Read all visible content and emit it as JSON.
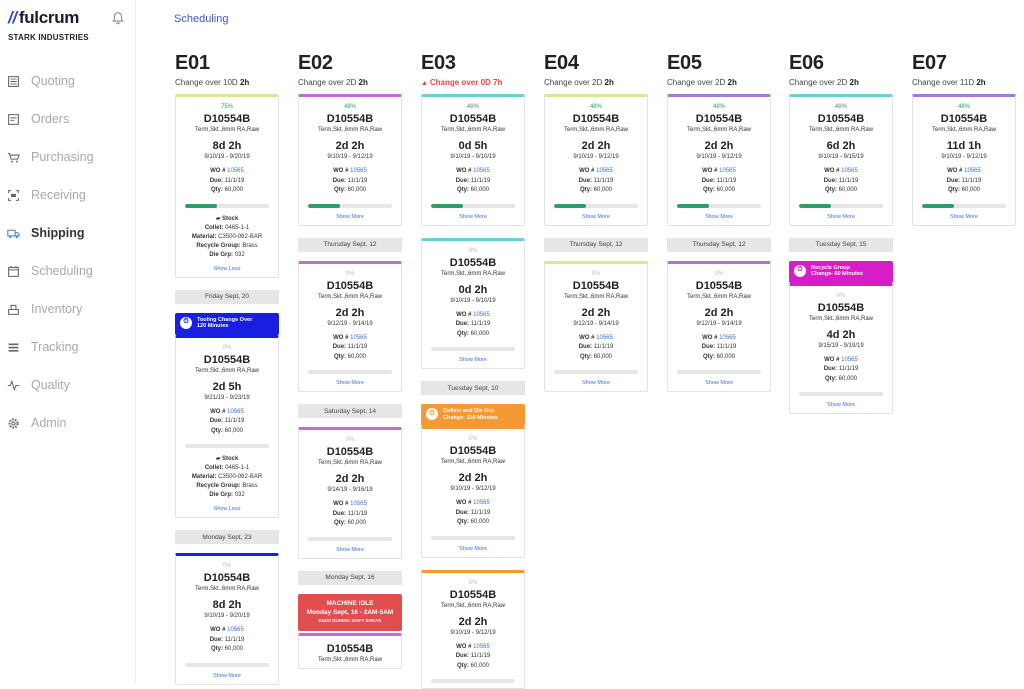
{
  "app": {
    "brand": "fulcrum",
    "company": "STARK INDUSTRIES"
  },
  "sidebar": {
    "items": [
      {
        "label": "Quoting",
        "icon": "quoting-icon"
      },
      {
        "label": "Orders",
        "icon": "orders-icon"
      },
      {
        "label": "Purchasing",
        "icon": "cart-icon"
      },
      {
        "label": "Receiving",
        "icon": "scan-icon"
      },
      {
        "label": "Shipping",
        "icon": "truck-icon",
        "active": true
      },
      {
        "label": "Scheduling",
        "icon": "calendar-icon"
      },
      {
        "label": "Inventory",
        "icon": "inventory-icon"
      },
      {
        "label": "Tracking",
        "icon": "tracking-icon"
      },
      {
        "label": "Quality",
        "icon": "pulse-icon"
      },
      {
        "label": "Admin",
        "icon": "gear-icon"
      }
    ]
  },
  "breadcrumb": "Scheduling",
  "colors": {
    "accent": "#3848c8",
    "green": "#2e9d68",
    "alert": "#e04848",
    "tooling": "#1a1ee0",
    "collets": "#f49a34",
    "recycle": "#d91cc9",
    "idle": "#e14e4e"
  },
  "machines": [
    {
      "id": "E01",
      "changeover_label": "Change over ",
      "changeover_days": "10D",
      "changeover_hours": "2h",
      "alert": false,
      "items": [
        {
          "type": "card",
          "color": "#dbe59a",
          "pct": "75%",
          "pct_color": "g",
          "part": "D10554B",
          "desc": "Term,Skt.,6mm RA,Raw",
          "dur": "8d 2h",
          "dates": "9/10/19 - 9/20/19",
          "wo": "10565",
          "due": "11/1/19",
          "qty": "60,000",
          "progress": 0.38,
          "tooling": {
            "stock": "Stock",
            "collet": "0465-1-1",
            "material": "C3500-062-BAR",
            "recycle": "Brass",
            "die": "032"
          },
          "more": "Show Less"
        },
        {
          "type": "date",
          "label": "Friday Sept, 20"
        },
        {
          "type": "change",
          "color": "#1a1ee0",
          "title": "Tooling Change Over",
          "sub": "120 Minutes"
        },
        {
          "type": "card",
          "color": "#1a1ee0",
          "pct": "0%",
          "part": "D10554B",
          "desc": "Term,Skt.,6mm RA,Raw",
          "dur": "2d 5h",
          "dates": "9/21/19 - 9/23/19",
          "wo": "10565",
          "due": "11/1/19",
          "qty": "60,000",
          "progress": 0,
          "tooling": {
            "stock": "Stock",
            "collet": "0465-1-1",
            "material": "C3500-062-BAR",
            "recycle": "Brass",
            "die": "032"
          },
          "more": "Show Less"
        },
        {
          "type": "date",
          "label": "Monday Sept, 23"
        },
        {
          "type": "card",
          "color": "#1a1ee0",
          "pct": "0%",
          "part": "D10554B",
          "desc": "Term,Skt.,6mm RA,Raw",
          "dur": "8d 2h",
          "dates": "9/10/19 - 9/20/19",
          "wo": "10565",
          "due": "11/1/19",
          "qty": "60,000",
          "progress": 0,
          "more": "Show More"
        }
      ]
    },
    {
      "id": "E02",
      "changeover_label": "Change over ",
      "changeover_days": "2D",
      "changeover_hours": "2h",
      "alert": false,
      "items": [
        {
          "type": "card",
          "color": "#c86ad6",
          "pct": "48%",
          "pct_color": "g",
          "part": "D10554B",
          "desc": "Term,Skt.,6mm RA,Raw",
          "dur": "2d 2h",
          "dates": "9/10/19 - 9/12/19",
          "wo": "10565",
          "due": "11/1/19",
          "qty": "60,000",
          "progress": 0.38,
          "more": "Show More"
        },
        {
          "type": "date",
          "label": "Thursday Sept, 12"
        },
        {
          "type": "card",
          "color": "#c86ad6",
          "pct": "0%",
          "part": "D10554B",
          "desc": "Term,Skt.,6mm RA,Raw",
          "dur": "2d 2h",
          "dates": "9/12/19 - 9/14/19",
          "wo": "10565",
          "due": "11/1/19",
          "qty": "60,000",
          "progress": 0,
          "more": "Show More"
        },
        {
          "type": "date",
          "label": "Saturday Sept, 14"
        },
        {
          "type": "card",
          "color": "#c86ad6",
          "pct": "0%",
          "part": "D10554B",
          "desc": "Term,Skt.,6mm RA,Raw",
          "dur": "2d 2h",
          "dates": "9/14/19 - 9/16/19",
          "wo": "10565",
          "due": "11/1/19",
          "qty": "60,000",
          "progress": 0,
          "more": "Show More"
        },
        {
          "type": "date",
          "label": "Monday Sept, 16"
        },
        {
          "type": "idle",
          "t1": "MACHINE IDLE",
          "t2": "Monday Sept, 16 - 2AM-5AM",
          "t3": "ENDS DURING SHIFT BREAK"
        },
        {
          "type": "card",
          "color": "#c86ad6",
          "pct": "",
          "part": "D10554B",
          "desc": "Term,Skt.,6mm RA,Raw",
          "dur": "",
          "dates": "",
          "wo": "",
          "due": "",
          "qty": "",
          "progress": 0,
          "more": ""
        }
      ]
    },
    {
      "id": "E03",
      "changeover_label": "Change over ",
      "changeover_days": "0D",
      "changeover_hours": "7h",
      "alert": true,
      "items": [
        {
          "type": "card",
          "color": "#6ad0d6",
          "pct": "48%",
          "pct_color": "g",
          "part": "D10554B",
          "desc": "Term,Skt.,6mm RA,Raw",
          "dur": "0d 5h",
          "dates": "9/10/19 - 9/10/19",
          "wo": "10565",
          "due": "11/1/19",
          "qty": "60,000",
          "progress": 0.38,
          "more": "Show More"
        },
        {
          "type": "card",
          "color": "#6ad0d6",
          "pct": "0%",
          "part": "D10554B",
          "desc": "Term,Skt.,6mm RA,Raw",
          "dur": "0d 2h",
          "dates": "9/10/19 - 9/10/19",
          "wo": "10565",
          "due": "11/1/19",
          "qty": "60,000",
          "progress": 0,
          "more": "Show More"
        },
        {
          "type": "date",
          "label": "Tuesday Sept, 10"
        },
        {
          "type": "change",
          "color": "#f49a34",
          "title": "Collets and Die Grp.",
          "sub": "Change- 110 Minutes"
        },
        {
          "type": "card",
          "color": "#f49a34",
          "pct": "0%",
          "part": "D10554B",
          "desc": "Term,Skt.,6mm RA,Raw",
          "dur": "2d 2h",
          "dates": "9/10/19 - 9/12/19",
          "wo": "10565",
          "due": "11/1/19",
          "qty": "60,000",
          "progress": 0,
          "more": "Show More"
        },
        {
          "type": "card",
          "color": "#f49a34",
          "pct": "0%",
          "part": "D10554B",
          "desc": "Term,Skt.,6mm RA,Raw",
          "dur": "2d 2h",
          "dates": "9/10/19 - 9/12/19",
          "wo": "10565",
          "due": "11/1/19",
          "qty": "60,000",
          "progress": 0,
          "more": ""
        }
      ]
    },
    {
      "id": "E04",
      "changeover_label": "Change over ",
      "changeover_days": "2D",
      "changeover_hours": "2h",
      "alert": false,
      "items": [
        {
          "type": "card",
          "color": "#dbe59a",
          "pct": "48%",
          "pct_color": "g",
          "part": "D10554B",
          "desc": "Term,Skt.,6mm RA,Raw",
          "dur": "2d 2h",
          "dates": "9/10/19 - 9/12/19",
          "wo": "10565",
          "due": "11/1/19",
          "qty": "60,000",
          "progress": 0.38,
          "more": "Show More"
        },
        {
          "type": "date",
          "label": "Thursday Sept, 12"
        },
        {
          "type": "card",
          "color": "#dbe59a",
          "pct": "0%",
          "part": "D10554B",
          "desc": "Term,Skt.,6mm RA,Raw",
          "dur": "2d 2h",
          "dates": "9/12/19 - 9/14/19",
          "wo": "10565",
          "due": "11/1/19",
          "qty": "60,000",
          "progress": 0,
          "more": "Show More"
        }
      ]
    },
    {
      "id": "E05",
      "changeover_label": "Change over ",
      "changeover_days": "2D",
      "changeover_hours": "2h",
      "alert": false,
      "items": [
        {
          "type": "card",
          "color": "#a978d6",
          "pct": "48%",
          "pct_color": "g",
          "part": "D10554B",
          "desc": "Term,Skt.,6mm RA,Raw",
          "dur": "2d 2h",
          "dates": "9/10/19 - 9/12/19",
          "wo": "10565",
          "due": "11/1/19",
          "qty": "60,000",
          "progress": 0.38,
          "more": "Show More"
        },
        {
          "type": "date",
          "label": "Thursday Sept, 12"
        },
        {
          "type": "card",
          "color": "#a978d6",
          "pct": "0%",
          "part": "D10554B",
          "desc": "Term,Skt.,6mm RA,Raw",
          "dur": "2d 2h",
          "dates": "9/12/19 - 9/14/19",
          "wo": "10565",
          "due": "11/1/19",
          "qty": "60,000",
          "progress": 0,
          "more": "Show More"
        }
      ]
    },
    {
      "id": "E06",
      "changeover_label": "Change over ",
      "changeover_days": "2D",
      "changeover_hours": "2h",
      "alert": false,
      "items": [
        {
          "type": "card",
          "color": "#6ad0d6",
          "pct": "48%",
          "pct_color": "g",
          "part": "D10554B",
          "desc": "Term,Skt.,6mm RA,Raw",
          "dur": "6d 2h",
          "dates": "9/10/19 - 9/15/19",
          "wo": "10565",
          "due": "11/1/19",
          "qty": "60,000",
          "progress": 0.38,
          "more": "Show More"
        },
        {
          "type": "date",
          "label": "Tuesday Sept, 15"
        },
        {
          "type": "change",
          "color": "#d91cc9",
          "title": "Recycle Group",
          "sub": "Change- 60 Minutes"
        },
        {
          "type": "card",
          "color": "#d91cc9",
          "pct": "0%",
          "part": "D10554B",
          "desc": "Term,Skt.,6mm RA,Raw",
          "dur": "4d 2h",
          "dates": "9/15/19 - 9/19/19",
          "wo": "10565",
          "due": "11/1/19",
          "qty": "60,000",
          "progress": 0,
          "more": "Show More"
        }
      ]
    },
    {
      "id": "E07",
      "changeover_label": "Change over ",
      "changeover_days": "11D",
      "changeover_hours": "2h",
      "alert": false,
      "items": [
        {
          "type": "card",
          "color": "#a978d6",
          "pct": "48%",
          "pct_color": "g",
          "part": "D10554B",
          "desc": "Term,Skt.,6mm RA,Raw",
          "dur": "11d 1h",
          "dates": "9/10/19 - 9/12/19",
          "wo": "10565",
          "due": "11/1/19",
          "qty": "60,000",
          "progress": 0.38,
          "more": "Show More"
        }
      ]
    }
  ],
  "labels": {
    "wo": "WO #",
    "due": "Due:",
    "qty": "Qty:",
    "collet": "Collet:",
    "material": "Material:",
    "recycle": "Recycle Group:",
    "die": "Die Grp:"
  }
}
